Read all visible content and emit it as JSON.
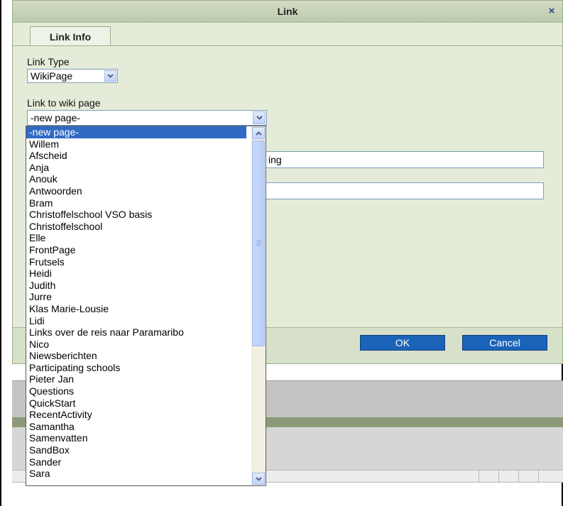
{
  "dialog": {
    "title": "Link",
    "close_glyph": "×",
    "tab_label": "Link Info",
    "link_type_label": "Link Type",
    "link_type_value": "WikiPage",
    "wiki_page_label": "Link to wiki page",
    "wiki_page_value": "-new page-",
    "input1_visible_text": "ing",
    "input2_visible_text": "",
    "ok_label": "OK",
    "cancel_label": "Cancel"
  },
  "dropdown": {
    "selected": "-new page-",
    "items": [
      "-new page-",
      " Willem",
      "Afscheid",
      "Anja",
      "Anouk",
      "Antwoorden",
      "Bram",
      "Christoffelschool VSO basis",
      "Christoffelschool",
      "Elle",
      "FrontPage",
      "Frutsels",
      "Heidi",
      "Judith",
      "Jurre",
      "Klas Marie-Lousie",
      "Lidi",
      "Links over de reis naar Paramaribo",
      "Nico",
      "Niewsberichten",
      "Participating schools",
      "Pieter Jan",
      "Questions",
      "QuickStart",
      "RecentActivity",
      "Samantha",
      "Samenvatten",
      "SandBox",
      "Sander",
      "Sara"
    ]
  },
  "icons": {
    "dropdown_arrow": "chevron-down-icon",
    "scroll_up": "chevron-up-icon",
    "scroll_down": "chevron-down-icon",
    "close": "close-icon"
  },
  "colors": {
    "dialog_bg": "#e4ecd9",
    "titlebar": "#c6d2b6",
    "selection": "#316ac5",
    "button_blue": "#1b63b8"
  }
}
